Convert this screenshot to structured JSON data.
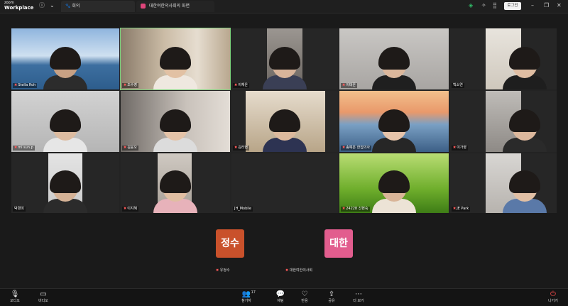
{
  "app": {
    "logo_top": "zoom",
    "logo_bottom": "Workplace"
  },
  "tabs": {
    "meeting": "회의",
    "webinar": "대한여한의사회의 화면"
  },
  "header": {
    "login": "로그인"
  },
  "tiles": [
    {
      "name": "Stella Roh"
    },
    {
      "name": "조수영"
    },
    {
      "name": "이채은"
    },
    {
      "name": "이태은"
    },
    {
      "name": "백소연"
    },
    {
      "name": "mi sun.p"
    },
    {
      "name": "김윤오"
    },
    {
      "name": "김라현"
    },
    {
      "name": "송예은 한집의사"
    },
    {
      "name": "이가영"
    },
    {
      "name": "박경미"
    },
    {
      "name": "이지혜"
    },
    {
      "name": "JH_Mobile"
    },
    {
      "name": "24228 신현숙"
    },
    {
      "name": "JE Park"
    }
  ],
  "audio_only": [
    {
      "initials": "정수",
      "name": "유정수",
      "color": "#c9512b"
    },
    {
      "initials": "대한",
      "name": "대한여한의사회",
      "color": "#e25d8e"
    }
  ],
  "toolbar": {
    "audio": "오디오",
    "video": "비디오",
    "participants": "참가자",
    "participants_count": "17",
    "chat": "채팅",
    "react": "반응",
    "share": "공유",
    "more": "더 보기",
    "leave": "나가기"
  }
}
